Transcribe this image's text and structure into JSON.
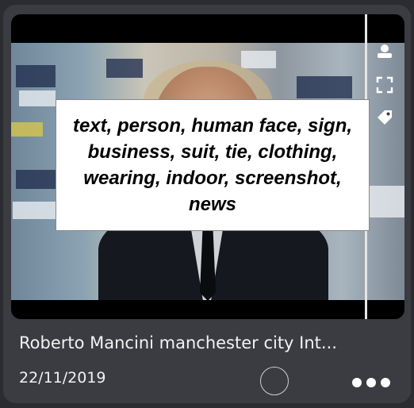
{
  "card": {
    "title": "Roberto Mancini manchester city Int...",
    "date": "22/11/2019",
    "tags": "text, person, human face, sign, business, suit, tie, clothing, wearing, indoor, screenshot, news",
    "icons": [
      "person-icon",
      "fullscreen-icon",
      "tag-icon",
      "select-circle-icon",
      "more-icon"
    ]
  }
}
